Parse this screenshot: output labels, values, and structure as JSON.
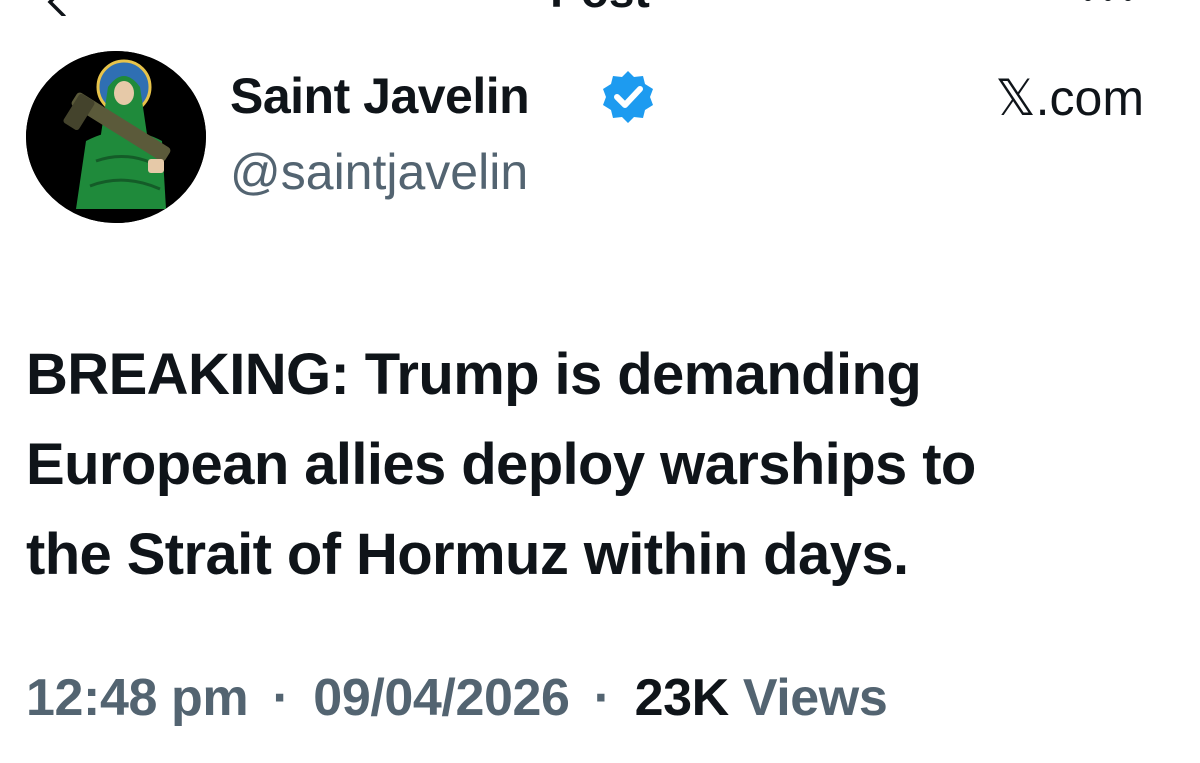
{
  "header": {
    "title": "Post"
  },
  "author": {
    "name": "Saint Javelin",
    "handle": "@saintjavelin",
    "verified": true,
    "avatar_icon": "saint-with-javelin-avatar"
  },
  "source": "𝕏.com",
  "post": {
    "lines": [
      "BREAKING: Trump is demanding",
      "European allies deploy warships to",
      "the Strait of Hormuz within days."
    ]
  },
  "meta": {
    "time": "12:48 pm",
    "separator": "·",
    "date": "09/04/2026",
    "views_count": "23K",
    "views_label": "Views"
  },
  "colors": {
    "text": "#0f1419",
    "secondary": "#536471",
    "verified": "#1d9bf0"
  }
}
